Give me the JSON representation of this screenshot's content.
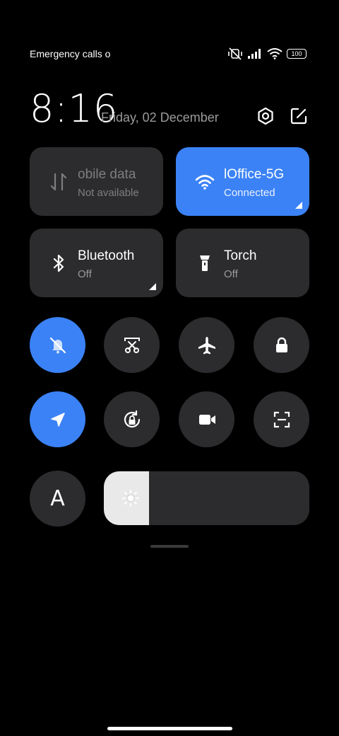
{
  "status": {
    "carrier_text": "Emergency calls o",
    "battery": "100"
  },
  "header": {
    "time": "8:16",
    "date": "Friday, 02 December"
  },
  "tiles": {
    "mobile_data": {
      "title": "obile data",
      "subtitle": "Not available"
    },
    "wifi": {
      "title": "lOffice-5G",
      "subtitle": "Connected"
    },
    "bluetooth": {
      "title": "Bluetooth",
      "subtitle": "Off"
    },
    "torch": {
      "title": "Torch",
      "subtitle": "Off"
    }
  },
  "controls": {
    "font_label": "A",
    "brightness_level": 0.22
  },
  "colors": {
    "accent": "#3b82f6",
    "tile_bg": "#2c2c2e",
    "background": "#000000"
  }
}
